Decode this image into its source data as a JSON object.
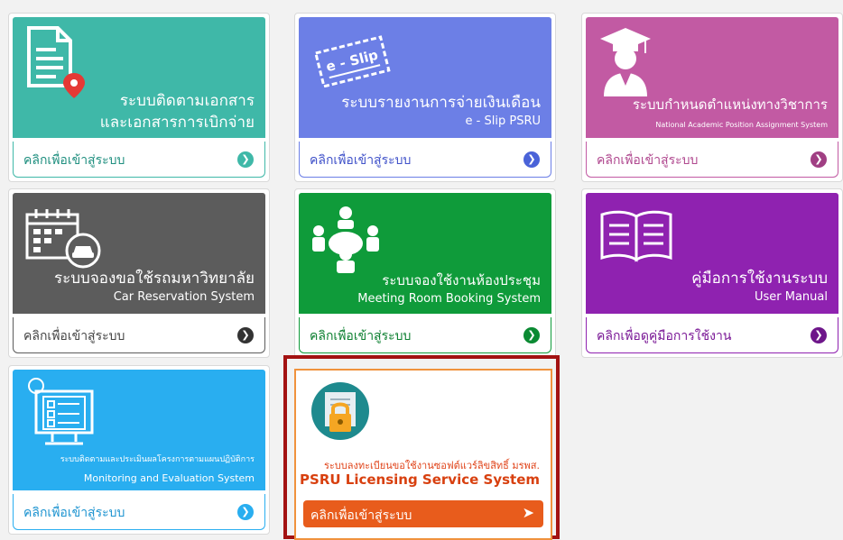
{
  "cards": [
    {
      "title1": "ระบบติดตามเอกสาร",
      "title2": "และเอกสารการเบิกจ่าย",
      "link": "คลิกเพื่อเข้าสู่ระบบ",
      "icon": "document-location-icon",
      "color": "#3fb8a8"
    },
    {
      "badge": "e - Slip",
      "title1": "ระบบรายงานการจ่ายเงินเดือน",
      "sub": "e - Slip PSRU",
      "link": "คลิกเพื่อเข้าสู่ระบบ",
      "icon": "e-slip-ticket-icon",
      "color": "#6c7fe6"
    },
    {
      "title1": "ระบบกำหนดตำแหน่งทางวิชาการ",
      "sub": "National Academic Position Assignment System",
      "link": "คลิกเพื่อเข้าสู่ระบบ",
      "icon": "graduate-icon",
      "color": "#c25aa3"
    },
    {
      "title1": "ระบบจองขอใช้รถมหาวิทยาลัย",
      "sub": "Car Reservation System",
      "link": "คลิกเพื่อเข้าสู่ระบบ",
      "icon": "calendar-car-icon",
      "color": "#5c5c5c"
    },
    {
      "title1": "ระบบจองใช้งานห้องประชุม",
      "sub": "Meeting Room Booking System",
      "link": "คลิกเพื่อเข้าสู่ระบบ",
      "icon": "meeting-icon",
      "color": "#0f9b3a"
    },
    {
      "title1": "คู่มือการใช้งานระบบ",
      "sub": "User Manual",
      "link": "คลิกเพื่อดูคู่มือการใช้งาน",
      "icon": "book-icon",
      "color": "#8f22b0"
    },
    {
      "title1": "ระบบติดตามและประเมินผลโครงการตามแผนปฏิบัติการ",
      "sub": "Monitoring and Evaluation System",
      "link": "คลิกเพื่อเข้าสู่ระบบ",
      "icon": "checklist-monitor-icon",
      "color": "#29aef0"
    },
    {
      "title1": "ระบบลงทะเบียนขอใช้งานซอฟต์แวร์ลิขสิทธิ์ มรพส.",
      "sub": "PSRU Licensing Service System",
      "link": "คลิกเพื่อเข้าสู่ระบบ",
      "icon": "license-lock-icon",
      "color": "#e85c1c"
    }
  ]
}
